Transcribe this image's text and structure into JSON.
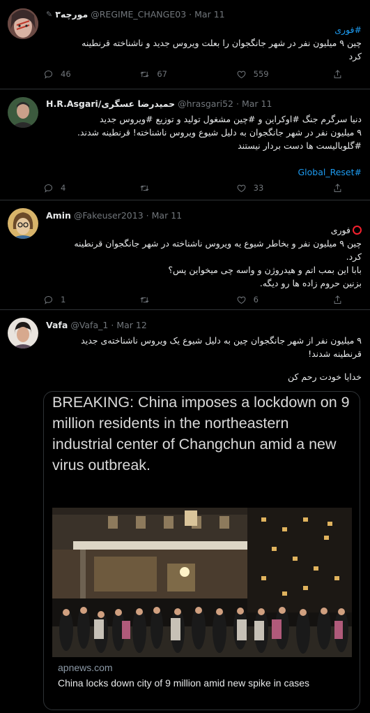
{
  "tweets": [
    {
      "name": "مورچه۳",
      "handle": "@REGIME_CHANGE03",
      "dot": "·",
      "time": "Mar 11",
      "line1_tag": "#فوری",
      "line2": "چین ۹ میلیون نفر در شهر جانگجوان را بعلت ویروس جدید و ناشناخته قرنطینه",
      "line3": "کرد",
      "replies": "46",
      "retweets": "67",
      "likes": "559"
    },
    {
      "name": "H.R.Asgari/حمیدرضا عسگری",
      "handle": "@hrasgari52",
      "dot": "·",
      "time": "Mar 11",
      "line1": "دنیا سرگرم جنگ #اوکراین و #چین مشغول تولید و توزیع #ویروس جدید",
      "line2": "۹ میلیون نفر در شهر جانگجوان به دلیل شیوع ویروس ناشناخته! قرنطینه شدند.",
      "line3": "#گلوبالیست ها دست بردار نیستند",
      "line4_tag": "#Global_Reset",
      "replies": "4",
      "retweets": "",
      "likes": "33"
    },
    {
      "name": "Amin",
      "handle": "@Fakeuser2013",
      "dot": "·",
      "time": "Mar 11",
      "line1": "فوری",
      "line2": "چین ۹ میلیون نفر و بخاطر شیوع یه ویروس ناشناخته در شهر جانگجوان قرنطینه",
      "line3": "کرد.",
      "line4": "بابا این بمب اتم و هیدروژن و واسه چی میخواین پس؟",
      "line5": "بزنین حروم زاده ها رو دیگه.",
      "replies": "1",
      "retweets": "",
      "likes": "6"
    },
    {
      "name": "Vafa",
      "handle": "@Vafa_1",
      "dot": "·",
      "time": "Mar 12",
      "line1": "۹ میلیون نفر از شهر جانگجوان چین به دلیل شیوع یک ویروس ناشناخته‌ی جدید",
      "line2": "قرنطینه شدند!",
      "line3": "خدایا خودت رحم کن",
      "card": {
        "headline": "BREAKING: China imposes a lockdown on 9 million residents in the northeastern industrial center of Changchun amid a new virus outbreak.",
        "domain": "apnews.com",
        "title": "China locks down city of 9 million amid new spike in cases"
      }
    }
  ],
  "icons": [
    "reply-icon",
    "retweet-icon",
    "like-icon",
    "share-icon",
    "red-circle-icon"
  ],
  "colors": {
    "background": "#000000",
    "link": "#1d9bf0",
    "muted": "#71767b",
    "text": "#e7e9ea",
    "alert": "#f4212e"
  }
}
